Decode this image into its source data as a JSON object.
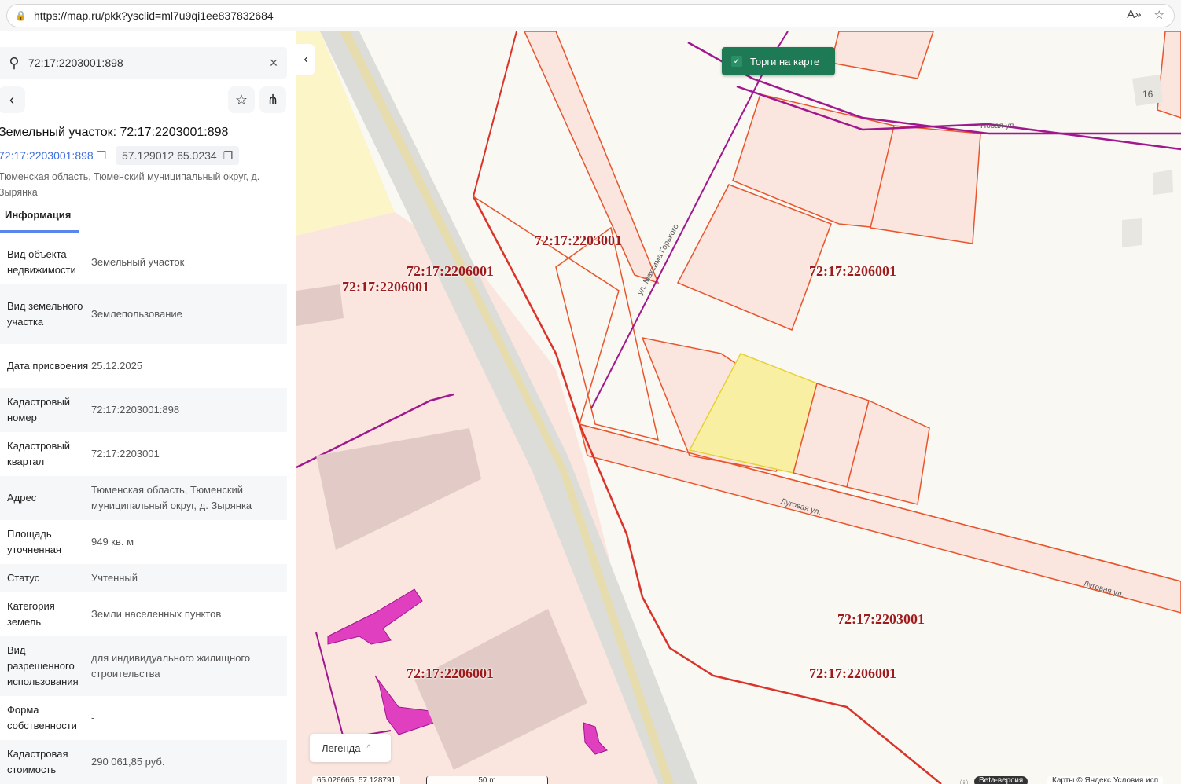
{
  "browser": {
    "url": "https://map.ru/pkk?ysclid=ml7u9qi1ee837832684",
    "read_aloud_icon": "read-aloud-icon",
    "favorite_icon": "star-icon"
  },
  "search": {
    "value": "72:17:2203001:898"
  },
  "object": {
    "title": "Земельный участок: 72:17:2203001:898",
    "cad_number": "72:17:2203001:898",
    "coords": "57.129012 65.0234",
    "address": "Тюменская область, Тюменский муниципальный округ, д. Зырянка"
  },
  "tabs": [
    {
      "label": "Информация"
    }
  ],
  "info": [
    {
      "k": "Вид объекта недвижимости",
      "v": "Земельный участок"
    },
    {
      "k": "Вид земельного участка",
      "v": "Землепользование"
    },
    {
      "k": "Дата присвоения",
      "v": "25.12.2025"
    },
    {
      "k": "Кадастровый номер",
      "v": "72:17:2203001:898"
    },
    {
      "k": "Кадастровый квартал",
      "v": "72:17:2203001"
    },
    {
      "k": "Адрес",
      "v": "Тюменская область, Тюменский муниципальный округ, д. Зырянка"
    },
    {
      "k": "Площадь уточненная",
      "v": "949 кв. м"
    },
    {
      "k": "Статус",
      "v": "Учтенный"
    },
    {
      "k": "Категория земель",
      "v": "Земли населенных пунктов"
    },
    {
      "k": "Вид разрешенного использования",
      "v": "для индивидуального жилищного строительства"
    },
    {
      "k": "Форма собственности",
      "v": "-"
    },
    {
      "k": "Кадастровая стоимость",
      "v": "290 061,85 руб."
    }
  ],
  "map": {
    "torgi_label": "Торги на карте",
    "legend_label": "Легенда",
    "quarters": [
      "72:17:2203001",
      "72:17:2206001",
      "72:17:2206001",
      "72:17:2206001",
      "72:17:2203001",
      "72:17:2206001",
      "72:17:2206001"
    ],
    "streets": {
      "novaya": "Новая ул.",
      "lugovaya1": "Луговая ул.",
      "lugovaya2": "Луговая ул.",
      "gorkogo": "ул. Максима Горького",
      "house": "16"
    },
    "cursor_coords": "65.026665, 57.128791",
    "scale": "50 m",
    "beta": "Beta-версия",
    "copyright": "Карты © Яндекс   Условия исп"
  }
}
